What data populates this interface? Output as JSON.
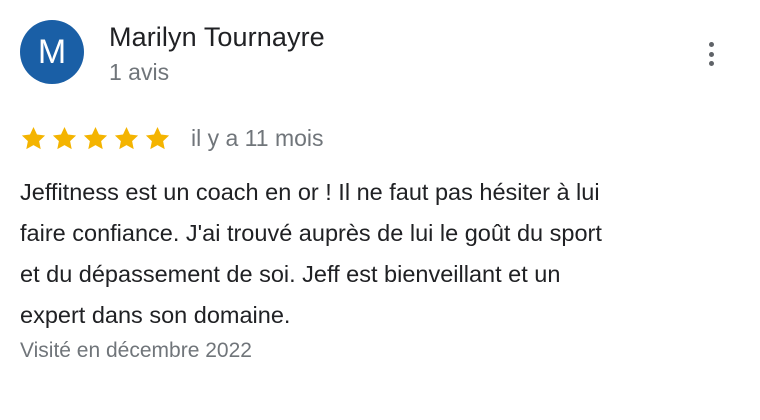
{
  "review": {
    "avatar_letter": "M",
    "avatar_color": "#1a5fa6",
    "author_name": "Marilyn Tournayre",
    "review_count": "1 avis",
    "more_icon": "more-vertical-icon",
    "rating": 5,
    "rating_max": 5,
    "star_color": "#f4b400",
    "date": "il y a 11 mois",
    "text_lines": [
      "Jeffitness est un coach en or ! Il ne faut pas hésiter à lui",
      "faire confiance. J'ai trouvé auprès de lui le goût du sport",
      "et du dépassement de soi. Jeff est bienveillant et un",
      "expert dans son domaine."
    ],
    "visit": "Visité en décembre 2022"
  }
}
